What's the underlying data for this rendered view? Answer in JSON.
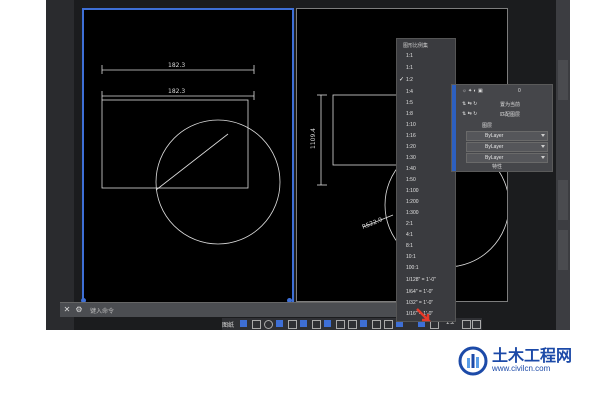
{
  "viewport_left": {
    "dim_top": "182.3",
    "dim_mid": "182.3"
  },
  "viewport_right": {
    "dim_vertical": "1109.4",
    "dim_radius": "R522.9"
  },
  "command_line": {
    "placeholder": "键入命令"
  },
  "status_bar": {
    "label": "图纸",
    "scale": "1:2"
  },
  "scale_menu": {
    "title": "图形比例集",
    "items": [
      "1:1",
      "1:1",
      "1:2",
      "1:4",
      "1:5",
      "1:8",
      "1:10",
      "1:16",
      "1:20",
      "1:30",
      "1:40",
      "1:50",
      "1:100",
      "1:200",
      "1:300",
      "2:1",
      "4:1",
      "8:1",
      "10:1",
      "100:1",
      "1/128\" = 1'-0\"",
      "1/64\" = 1'-0\"",
      "1/32\" = 1'-0\"",
      "1/16\" = 1'-0\""
    ],
    "checked": "1:2"
  },
  "properties_panel": {
    "layer_value": "0",
    "btn_current": "置为当前",
    "btn_match": "匹配图层",
    "layer_dropdown": "图层",
    "color": "ByLayer",
    "linetype": "ByLayer",
    "lineweight": "ByLayer",
    "plot_style": "特性"
  },
  "watermark": {
    "title": "土木工程网",
    "url": "www.civilcn.com"
  },
  "colors": {
    "viewport_border_active": "#3e6fd6",
    "watermark": "#1c4aa8",
    "arrow": "#e53a2a"
  }
}
